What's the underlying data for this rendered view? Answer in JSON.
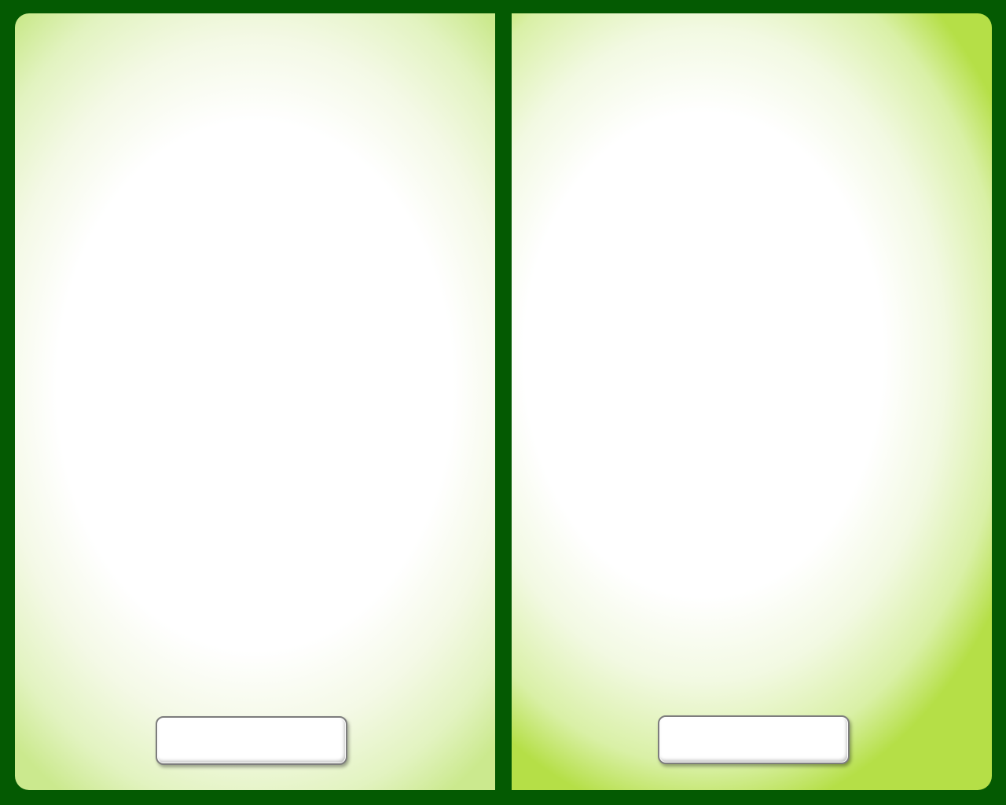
{
  "theme": {
    "frame_color": "#045a02",
    "panel_highlight": "#ffffff",
    "panel_edge_left": "#cbe98e",
    "panel_edge_right": "#b5df47",
    "field_border": "#7d7d7d"
  },
  "left_panel": {
    "button_label": ""
  },
  "right_panel": {
    "button_label": ""
  }
}
